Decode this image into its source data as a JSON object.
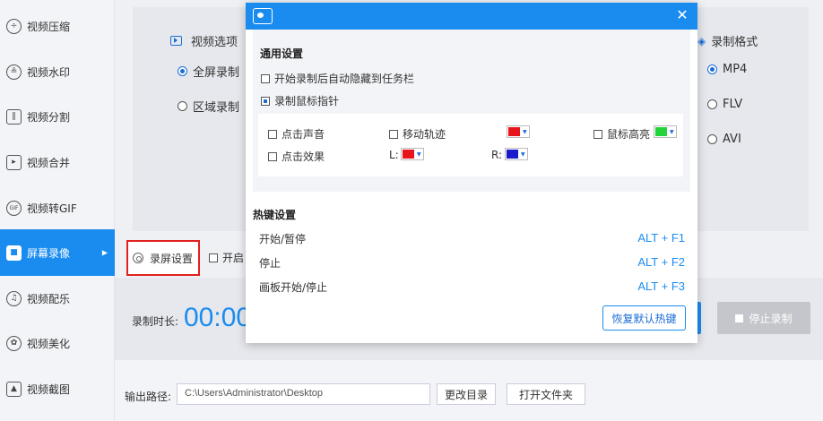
{
  "sidebar": {
    "items": [
      {
        "label": "视频压缩",
        "icon": "compress-icon"
      },
      {
        "label": "视频水印",
        "icon": "watermark-icon"
      },
      {
        "label": "视频分割",
        "icon": "split-icon"
      },
      {
        "label": "视频合并",
        "icon": "merge-icon"
      },
      {
        "label": "视频转GIF",
        "icon": "gif-icon"
      },
      {
        "label": "屏幕录像",
        "icon": "screen-record-icon"
      },
      {
        "label": "视频配乐",
        "icon": "music-icon"
      },
      {
        "label": "视频美化",
        "icon": "beautify-icon"
      },
      {
        "label": "视频截图",
        "icon": "screenshot-icon"
      }
    ],
    "active_index": 5
  },
  "main": {
    "video_options_title": "视频选项",
    "fullscreen_label": "全屏录制",
    "region_label": "区域录制",
    "format_title": "录制格式",
    "formats": [
      "MP4",
      "FLV",
      "AVI"
    ],
    "selected_format": "MP4",
    "settings_button": "录屏设置",
    "open_checkbox_label": "开启",
    "timer_label": "录制时长:",
    "timer_value": "00:00",
    "stop_button": "停止录制",
    "output_label": "输出路径:",
    "output_path": "C:\\Users\\Administrator\\Desktop",
    "change_dir_button": "更改目录",
    "open_folder_button": "打开文件夹"
  },
  "dialog": {
    "general_title": "通用设置",
    "auto_hide_label": "开始录制后自动隐藏到任务栏",
    "record_cursor_label": "录制鼠标指针",
    "click_sound_label": "点击声音",
    "move_track_label": "移动轨迹",
    "cursor_highlight_label": "鼠标高亮",
    "click_effect_label": "点击效果",
    "left_label": "L:",
    "right_label": "R:",
    "colors": {
      "track": "#e8141c",
      "highlight": "#22d33a",
      "left": "#e8141c",
      "right": "#1a1acc"
    },
    "hotkey_title": "热键设置",
    "hotkeys": [
      {
        "action": "开始/暂停",
        "key": "ALT + F1"
      },
      {
        "action": "停止",
        "key": "ALT + F2"
      },
      {
        "action": "画板开始/停止",
        "key": "ALT + F3"
      }
    ],
    "restore_button": "恢复默认热键"
  }
}
